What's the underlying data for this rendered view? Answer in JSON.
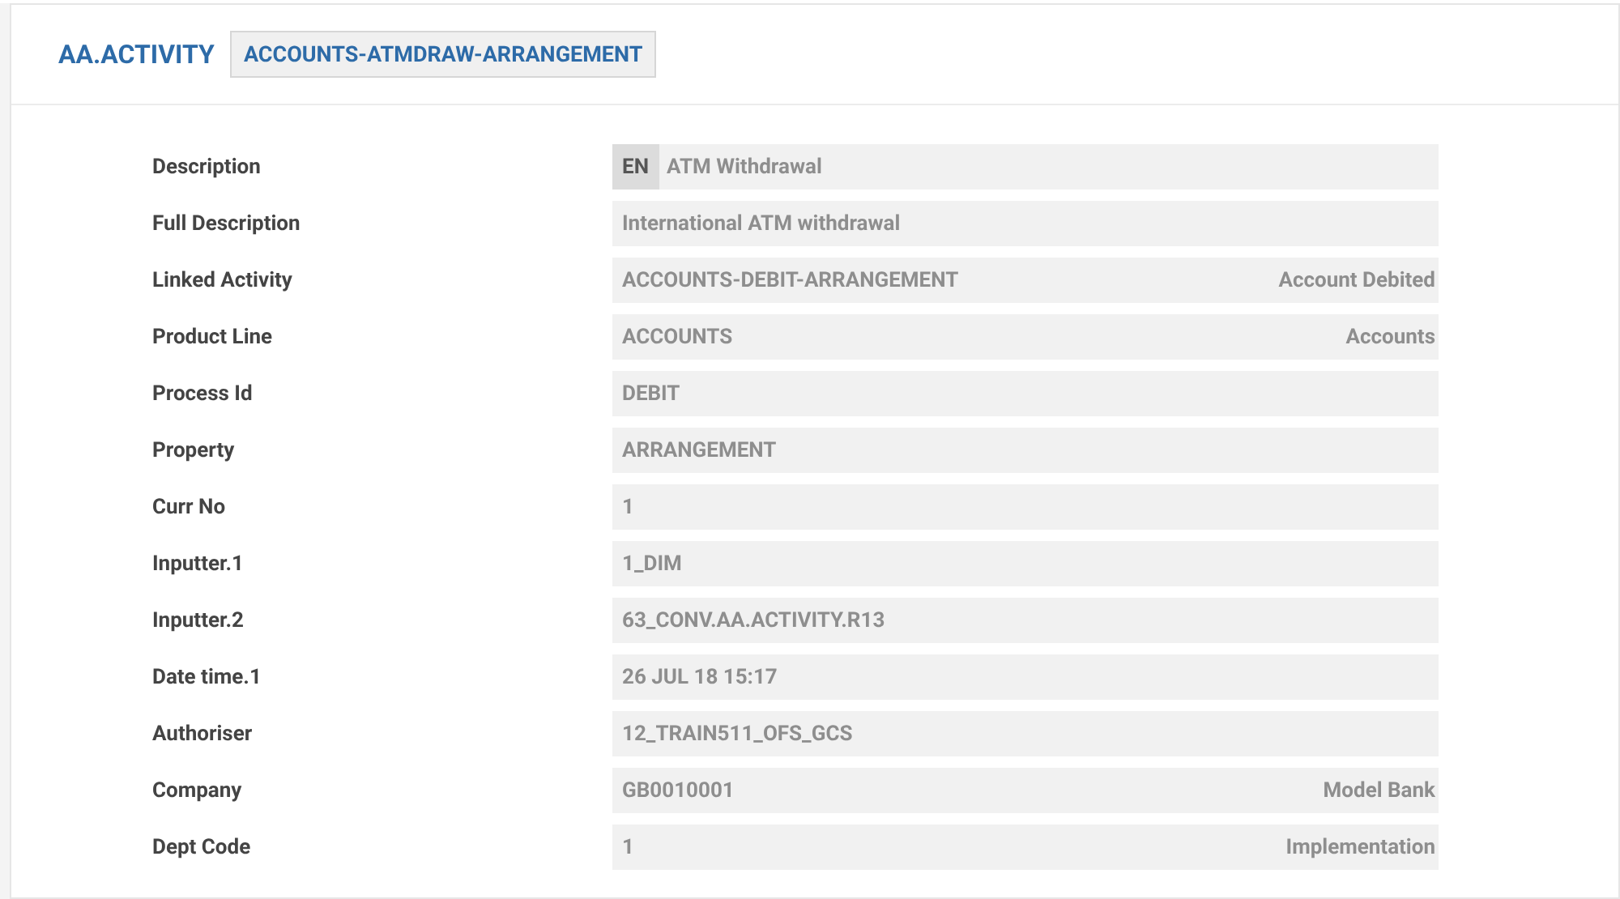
{
  "header": {
    "title": "AA.ACTIVITY",
    "record_id": "ACCOUNTS-ATMDRAW-ARRANGEMENT"
  },
  "fields": [
    {
      "label": "Description",
      "language": "EN",
      "value": "ATM Withdrawal"
    },
    {
      "label": "Full Description",
      "value": "International ATM withdrawal"
    },
    {
      "label": "Linked Activity",
      "value": "ACCOUNTS-DEBIT-ARRANGEMENT",
      "note": "Account Debited"
    },
    {
      "label": "Product Line",
      "value": "ACCOUNTS",
      "note": "Accounts"
    },
    {
      "label": "Process Id",
      "value": "DEBIT"
    },
    {
      "label": "Property",
      "value": "ARRANGEMENT"
    },
    {
      "label": "Curr No",
      "value": "1"
    },
    {
      "label": "Inputter.1",
      "value": "1_DIM"
    },
    {
      "label": "Inputter.2",
      "value": "63_CONV.AA.ACTIVITY.R13"
    },
    {
      "label": "Date time.1",
      "value": "26 JUL 18 15:17"
    },
    {
      "label": "Authoriser",
      "value": "12_TRAIN511_OFS_GCS"
    },
    {
      "label": "Company",
      "value": "GB0010001",
      "note": "Model Bank"
    },
    {
      "label": "Dept Code",
      "value": "1",
      "note": "Implementation"
    }
  ]
}
